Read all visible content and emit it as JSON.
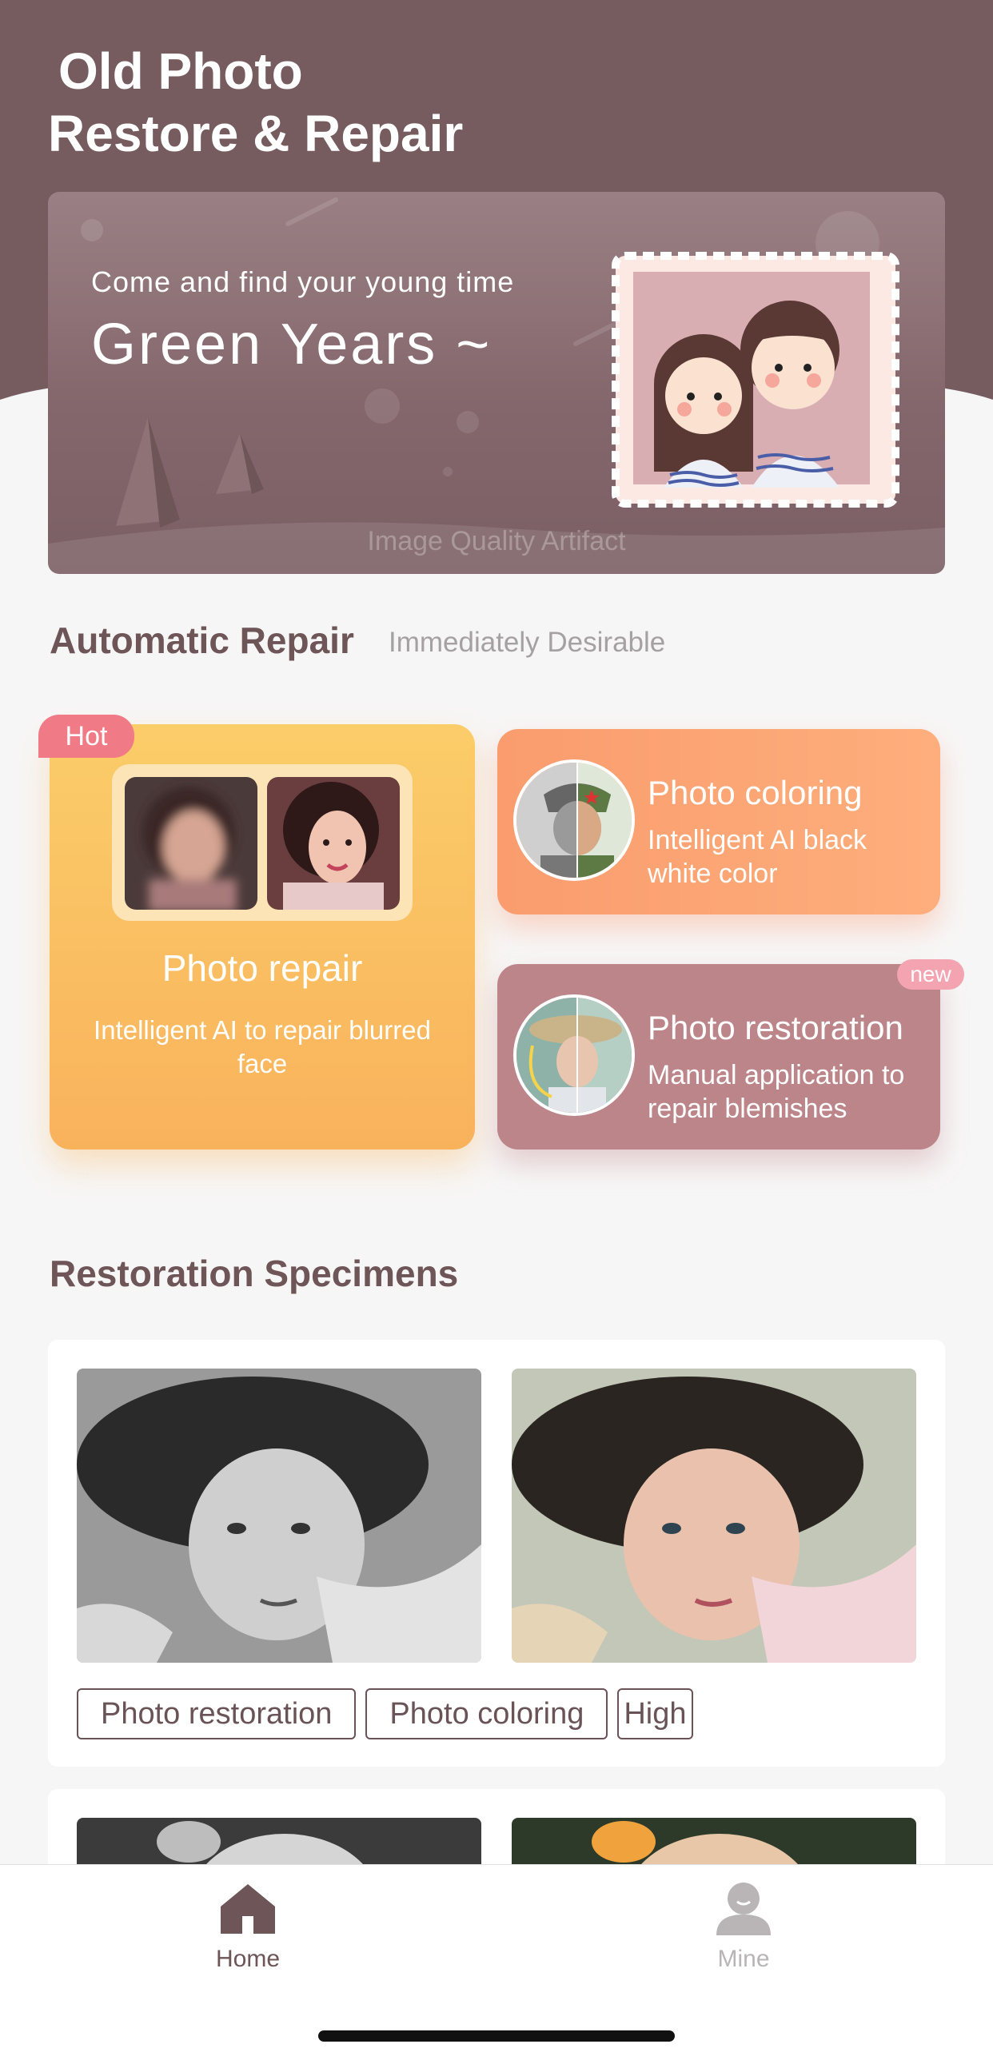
{
  "header": {
    "title_line1": "Old Photo",
    "title_line2": "Restore & Repair",
    "bg_color": "#765c5f"
  },
  "banner": {
    "subtitle": "Come and find your young time",
    "title": "Green Years ~",
    "watermark": "Image Quality Artifact"
  },
  "automatic_repair": {
    "title": "Automatic Repair",
    "subtitle": "Immediately Desirable",
    "repair_card": {
      "badge": "Hot",
      "title": "Photo repair",
      "description": "Intelligent AI to repair blurred face",
      "color": "#f9b75e"
    },
    "coloring_card": {
      "title": "Photo coloring",
      "description": "Intelligent AI black white color",
      "color": "#fb9f70"
    },
    "restoration_card": {
      "badge": "new",
      "title": "Photo restoration",
      "description": "Manual application to repair blemishes",
      "color": "#bc858a"
    }
  },
  "specimens": {
    "title": "Restoration Specimens",
    "items": [
      {
        "tags": [
          "Photo restoration",
          "Photo coloring",
          "High"
        ]
      }
    ]
  },
  "tabbar": {
    "tabs": [
      {
        "label": "Home",
        "icon": "home-icon",
        "active": true
      },
      {
        "label": "Mine",
        "icon": "person-icon",
        "active": false
      }
    ],
    "active_color": "#6e5557",
    "inactive_color": "#b9b5b6"
  }
}
